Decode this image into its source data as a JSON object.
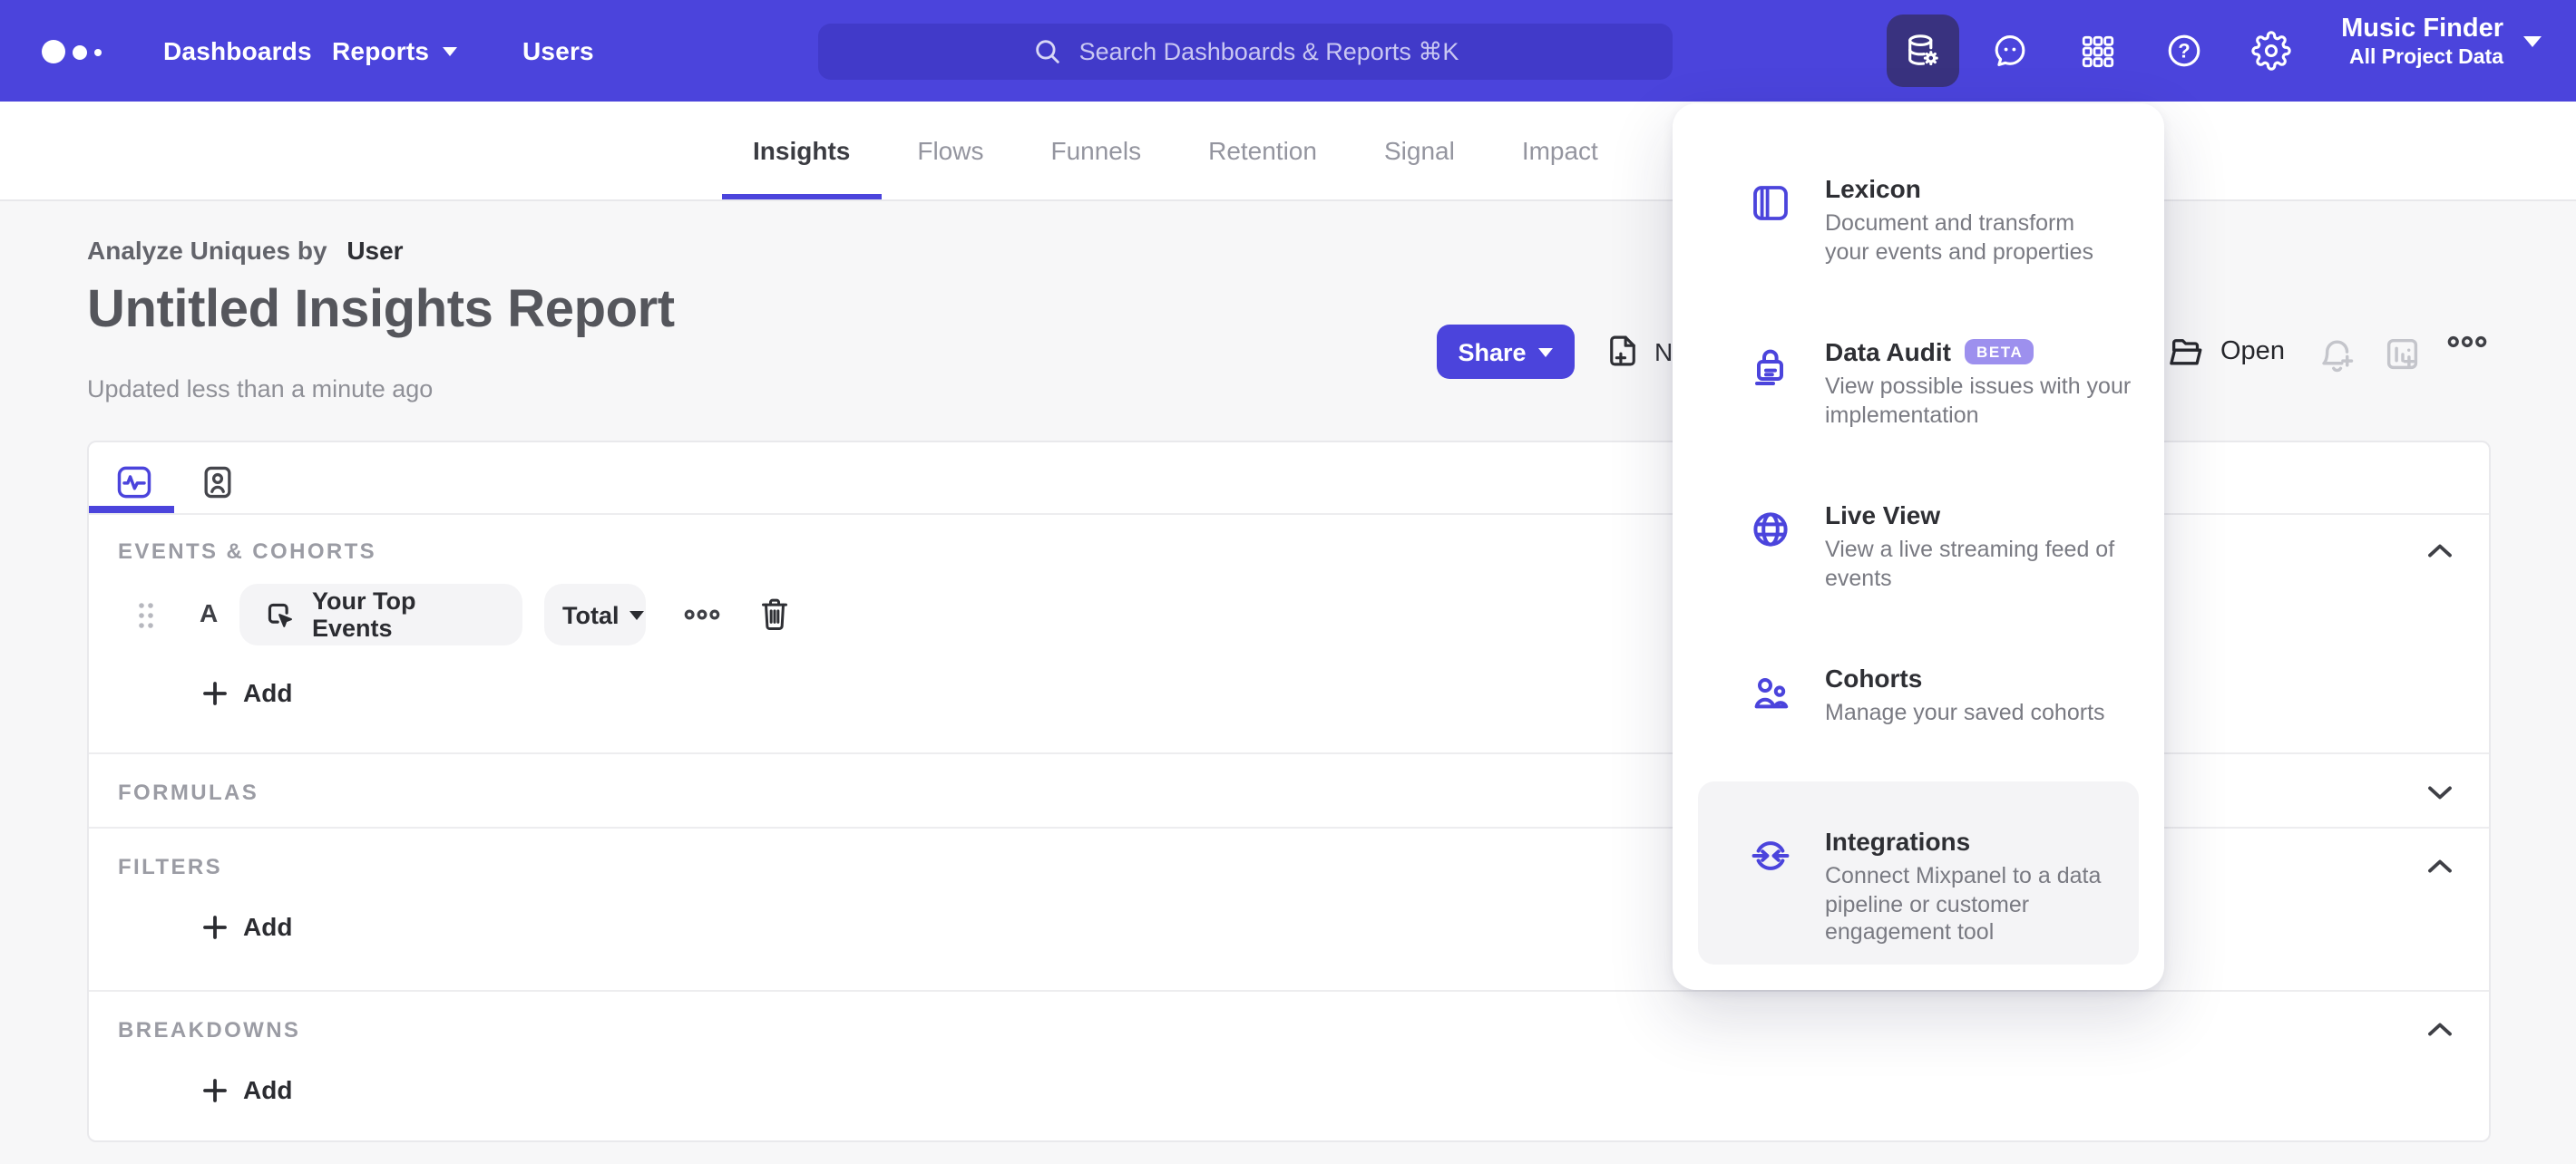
{
  "colors": {
    "nav_background": "#4B44DC",
    "nav_active_icon_background": "#39327F",
    "accent": "#4B44DC",
    "beta_badge": "#9D90EE",
    "content_background": "#F7F7F8"
  },
  "topnav": {
    "logo_icon": "mixpanel-dots",
    "links": [
      {
        "label": "Dashboards",
        "caret": false
      },
      {
        "label": "Reports",
        "caret": true
      },
      {
        "label": "Users",
        "caret": false
      }
    ],
    "search": {
      "placeholder": "Search Dashboards & Reports ⌘K",
      "icon": "search-icon"
    },
    "right_icons": [
      "data-management-icon",
      "feedback-icon",
      "apps-grid-icon",
      "help-icon",
      "settings-icon"
    ],
    "active_icon": "data-management-icon",
    "project": {
      "name": "Music Finder",
      "scope": "All Project Data"
    }
  },
  "report_tabs": {
    "items": [
      "Insights",
      "Flows",
      "Funnels",
      "Retention",
      "Signal",
      "Impact"
    ],
    "active": "Insights"
  },
  "report": {
    "analyze_by_label": "Analyze Uniques by",
    "analyze_by_value": "User",
    "title": "Untitled Insights Report",
    "updated_text": "Updated less than a minute ago",
    "share_button": "Share",
    "new_button_visible_text": "N",
    "open_button": "Open"
  },
  "builder": {
    "events_header": "EVENTS & COHORTS",
    "event_row": {
      "letter": "A",
      "event_name": "Your Top Events",
      "aggregation": "Total"
    },
    "add_button": "Add",
    "formulas_header": "FORMULAS",
    "filters_header": "FILTERS",
    "breakdowns_header": "BREAKDOWNS"
  },
  "apps_menu": {
    "items": [
      {
        "title": "Lexicon",
        "icon": "book-icon",
        "subtitle": "Document and transform\nyour events and properties"
      },
      {
        "title": "Data Audit",
        "icon": "lock-icon",
        "badge": "BETA",
        "subtitle": "View possible issues with your\nimplementation"
      },
      {
        "title": "Live View",
        "icon": "globe-icon",
        "subtitle": "View a live streaming feed of\nevents"
      },
      {
        "title": "Cohorts",
        "icon": "cohorts-people-icon",
        "subtitle": "Manage your saved cohorts"
      },
      {
        "title": "Integrations",
        "icon": "sync-arrows-icon",
        "subtitle": "Connect Mixpanel to a data\npipeline or customer\nengagement tool",
        "highlighted": true
      }
    ]
  }
}
